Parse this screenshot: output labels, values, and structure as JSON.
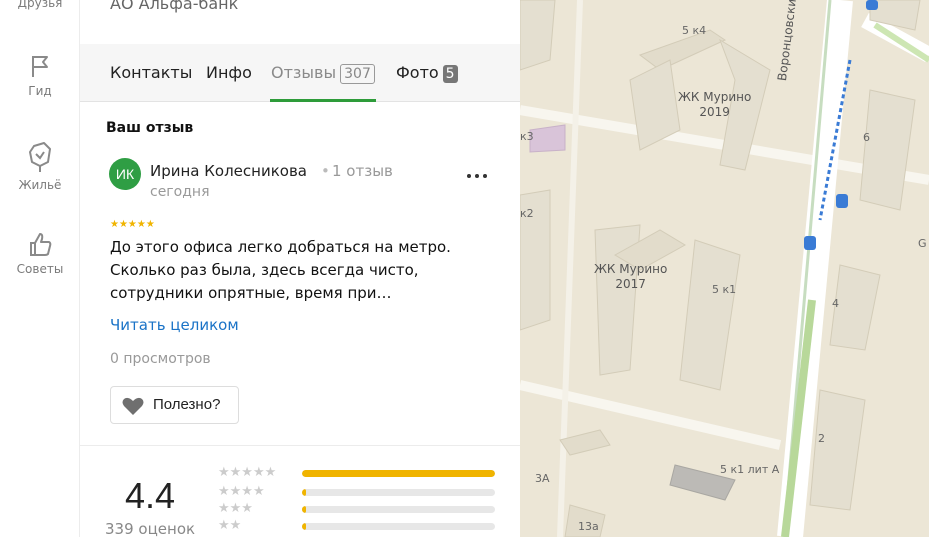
{
  "rail": {
    "items": [
      {
        "label": "Друзья"
      },
      {
        "label": "Гид"
      },
      {
        "label": "Жильё"
      },
      {
        "label": "Советы"
      }
    ]
  },
  "org": {
    "name": "АО Альфа-банк"
  },
  "tabs": [
    {
      "label": "Контакты"
    },
    {
      "label": "Инфо"
    },
    {
      "label": "Отзывы",
      "badge": "307"
    },
    {
      "label": "Фото",
      "badge": "5"
    }
  ],
  "review": {
    "section_title": "Ваш отзыв",
    "avatar_initials": "ИК",
    "author": "Ирина Колесникова",
    "separator": "•",
    "author_reviews": "1 отзыв",
    "date": "сегодня",
    "more": "…",
    "stars": "★★★★★",
    "rating": 5,
    "text_line1": "До этого офиса легко добраться на метро.",
    "text_line2": "Сколько раз была, здесь всегда чисто,",
    "text_line3": "сотрудники опрятные, время при…",
    "read_more": "Читать целиком",
    "views": "0 просмотров",
    "useful_label": "Полезно?"
  },
  "summary": {
    "rating": "4.4",
    "count": "339 оценок",
    "distribution": [
      {
        "stars": "★★★★★",
        "fraction": 1.0
      },
      {
        "stars": "★★★★",
        "fraction": 0.02
      },
      {
        "stars": "★★★",
        "fraction": 0.02
      },
      {
        "stars": "★★",
        "fraction": 0.02
      }
    ]
  },
  "map": {
    "labels": {
      "street": "Воронцовский бульвар",
      "complex_top_title": "ЖК Мурино",
      "complex_top_year": "2019",
      "complex_mid_title": "ЖК Мурино",
      "complex_mid_year": "2017",
      "b_5k4": "5 к4",
      "b_5k1": "5 к1",
      "b_5k1a": "5 к1 лит А",
      "b_6": "6",
      "b_4": "4",
      "b_2": "2",
      "b_k3": "к3",
      "b_k2": "к2",
      "b_3a": "3А",
      "b_13a": "13а",
      "b_g": "G"
    }
  },
  "colors": {
    "accent_green": "#2e9c3a",
    "link_blue": "#1a73c7",
    "star_gold": "#f0b400",
    "avatar_green": "#2f9e44"
  }
}
